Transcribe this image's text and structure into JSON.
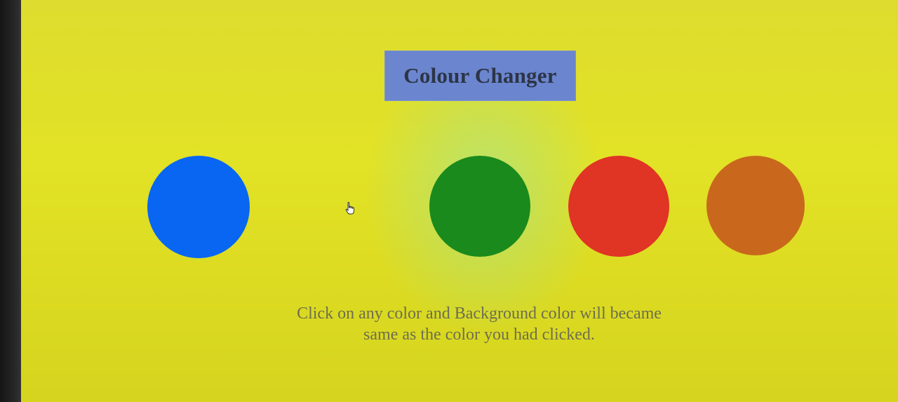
{
  "page": {
    "title": "Colour Changer",
    "description_line1": "Click on any color and Background color will became",
    "description_line2": "same as the color you had clicked."
  },
  "background_color": "#e0e028",
  "colors": [
    {
      "name": "blue",
      "hex": "#0866f2"
    },
    {
      "name": "green",
      "hex": "#1a8a1c"
    },
    {
      "name": "red",
      "hex": "#e03424"
    },
    {
      "name": "orange",
      "hex": "#c9681c"
    }
  ],
  "cursor": {
    "icon": "hand-pointer-icon"
  }
}
